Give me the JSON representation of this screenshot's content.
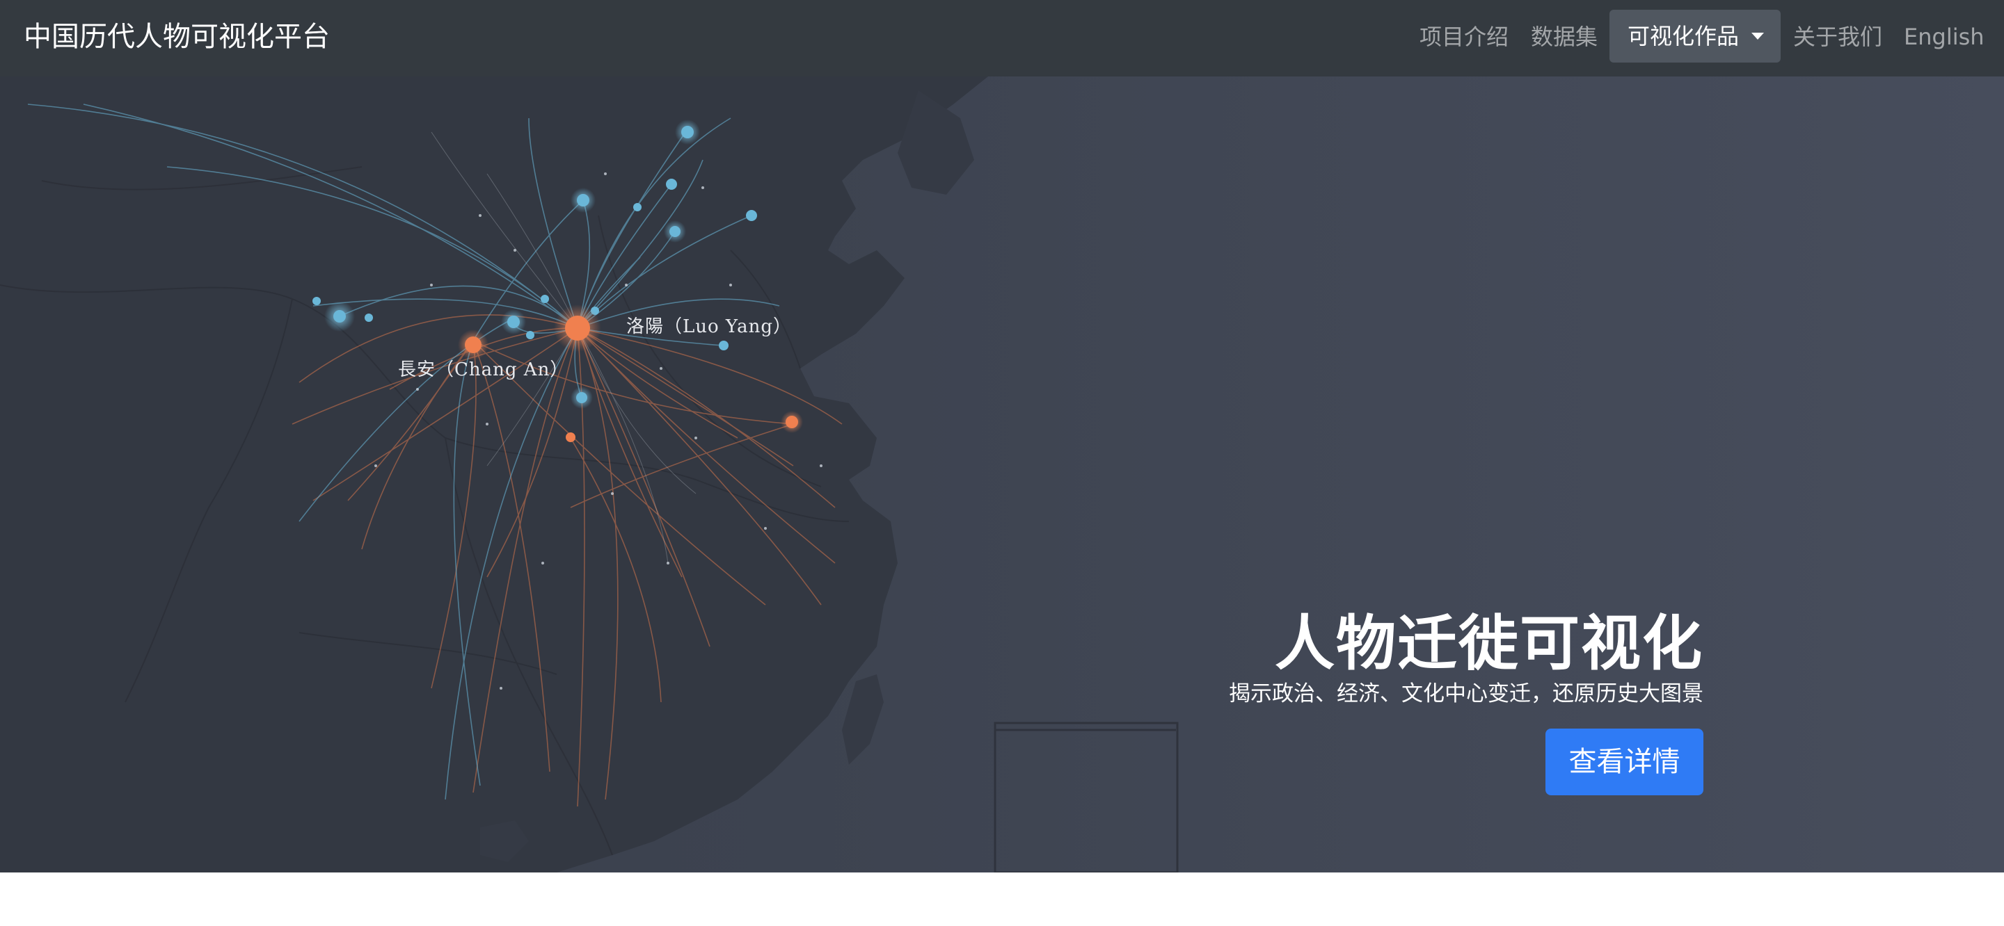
{
  "navbar": {
    "brand": "中国历代人物可视化平台",
    "items": [
      {
        "label": "项目介绍"
      },
      {
        "label": "数据集"
      },
      {
        "label": "可视化作品",
        "active": true
      },
      {
        "label": "关于我们"
      },
      {
        "label": "English"
      }
    ]
  },
  "hero": {
    "title": "人物迁徙可视化",
    "subtitle": "揭示政治、经济、文化中心变迁，还原历史大图景",
    "button_label": "查看详情",
    "map": {
      "labels": {
        "luoyang": "洛陽（Luo Yang）",
        "changan": "長安（Chang An）"
      },
      "colors": {
        "blue_flow": "#6ab7d8",
        "orange_flow": "#f0804f",
        "land": "#333842",
        "sea": "#434958"
      }
    }
  },
  "colors": {
    "navbar_bg": "#343a40",
    "primary_button": "#2f7bf5",
    "page_bg": "#ffffff"
  }
}
